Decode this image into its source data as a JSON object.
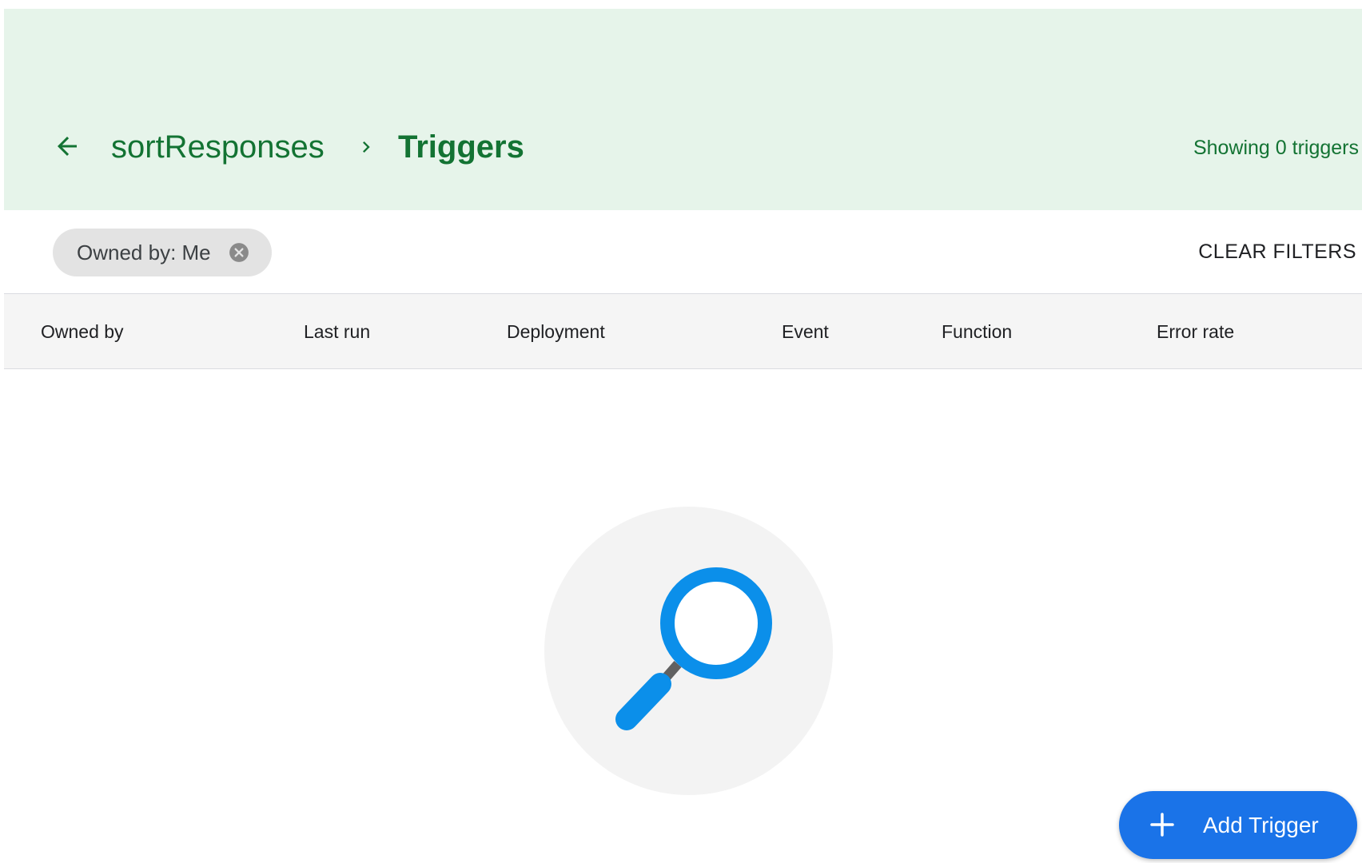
{
  "header": {
    "breadcrumb_parent": "sortResponses",
    "breadcrumb_current": "Triggers",
    "showing_text": "Showing 0 triggers"
  },
  "filters": {
    "chip_label": "Owned by: Me",
    "clear_label": "CLEAR FILTERS"
  },
  "table": {
    "columns": [
      "Owned by",
      "Last run",
      "Deployment",
      "Event",
      "Function",
      "Error rate"
    ]
  },
  "fab": {
    "label": "Add Trigger"
  },
  "icons": {
    "back": "arrow-back-icon",
    "separator": "chevron-right-icon",
    "chip_close": "cancel-icon",
    "empty": "magnifier-icon",
    "add": "plus-icon"
  },
  "colors": {
    "header_bg": "#e6f4ea",
    "header_text": "#137333",
    "accent": "#1a73e8",
    "magnifier": "#0b8fea"
  }
}
